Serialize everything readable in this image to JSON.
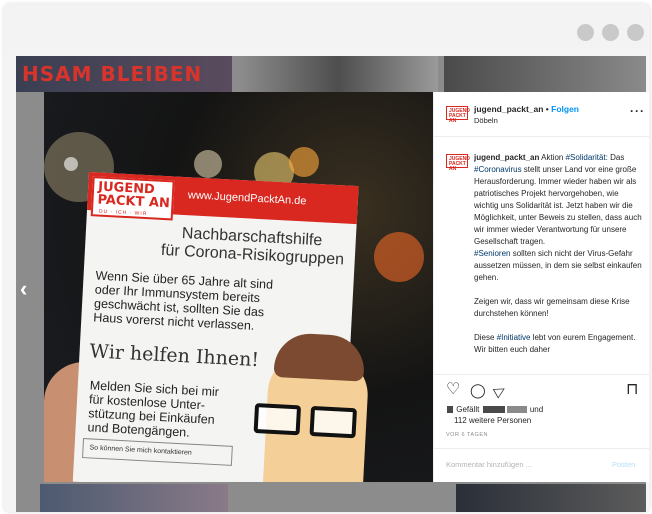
{
  "feed": {
    "banner_text": "HSAM BLEIBEN",
    "prev_arrow": "‹"
  },
  "flyer": {
    "logo_line1": "JUGEND",
    "logo_line2": "PACKT AN",
    "logo_sub": "DU · ICH · WIR",
    "url": "www.JugendPacktAn.de",
    "heading1": "Nachbarschaftshilfe",
    "heading2": "für Corona-Risikogruppen",
    "body": [
      "Wenn Sie über 65 Jahre alt sind",
      "oder Ihr Immunsystem bereits",
      "geschwächt ist, sollten Sie das",
      "Haus vorerst nicht verlassen."
    ],
    "wir_helfen": "Wir helfen Ihnen!",
    "offer": [
      "Melden Sie sich bei mir",
      "für kostenlose Unter-",
      "stützung bei Einkäufen",
      "und Botengängen."
    ],
    "contact_box": "So können Sie mich kontaktieren"
  },
  "image_nav": {
    "next": "›"
  },
  "post": {
    "avatar_text": "JUGEND PACKT AN",
    "username": "jugend_packt_an",
    "separator": " • ",
    "follow": "Folgen",
    "location": "Döbeln",
    "more": "···",
    "caption": {
      "p1_user": "jugend_packt_an",
      "p1_a": " Aktion ",
      "p1_tag1": "#Solidarität",
      "p1_b": ": Das ",
      "p1_tag2": "#Coronavirus",
      "p1_c": " stellt unser Land vor eine große Herausforderung. Immer wieder haben wir als patriotisches Projekt hervorgehoben, wie wichtig uns Solidarität ist. Jetzt haben wir die Möglichkeit, unter Beweis zu stellen, dass auch wir immer wieder Verantwortung für unsere Gesellschaft tragen.",
      "p2_tag": "#Senioren",
      "p2_text": " sollten sich nicht der Virus-Gefahr aussetzen müssen, in dem sie selbst einkaufen gehen.",
      "p3": "Zeigen wir, dass wir gemeinsam diese Krise durchstehen können!",
      "p4_a": "Diese ",
      "p4_tag": "#Initiative",
      "p4_b": " lebt von eurem Engagement. Wir bitten euch daher"
    },
    "actions": {
      "like_icon": "♡",
      "comment_icon": "◯",
      "share_icon": "▷",
      "save_icon": "⊓"
    },
    "likes_prefix": "Gefällt",
    "likes_and": "und",
    "likes_others": "112 weitere Personen",
    "timestamp": "VOR 6 TAGEN",
    "comment_placeholder": "Kommentar hinzufügen ...",
    "post_button": "Posten"
  }
}
